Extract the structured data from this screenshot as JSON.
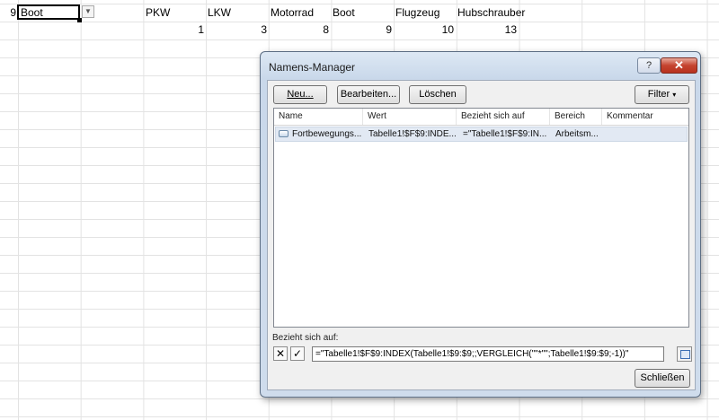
{
  "sheet": {
    "row_number": "9",
    "active_cell_value": "Boot",
    "headers": [
      "PKW",
      "LKW",
      "Motorrad",
      "Boot",
      "Flugzeug",
      "Hubschrauber"
    ],
    "numbers": [
      "1",
      "3",
      "8",
      "9",
      "10",
      "13"
    ]
  },
  "dialog": {
    "title": "Namens-Manager",
    "help_glyph": "?",
    "close_glyph": "✕",
    "buttons": {
      "new": "Neu...",
      "edit": "Bearbeiten...",
      "delete": "Löschen",
      "filter": "Filter",
      "close": "Schließen"
    },
    "columns": [
      "Name",
      "Wert",
      "Bezieht sich auf",
      "Bereich",
      "Kommentar"
    ],
    "rows": [
      {
        "name": "Fortbewegungs...",
        "value": "Tabelle1!$F$9:INDE...",
        "refers_to": "=\"Tabelle1!$F$9:IN...",
        "scope": "Arbeitsm...",
        "comment": ""
      }
    ],
    "refers_label": "Bezieht sich auf:",
    "formula": "=\"Tabelle1!$F$9:INDEX(Tabelle1!$9:$9;;VERGLEICH(\"\"*\"\";Tabelle1!$9:$9;-1))\"",
    "cancel_glyph": "✕",
    "confirm_glyph": "✓"
  }
}
